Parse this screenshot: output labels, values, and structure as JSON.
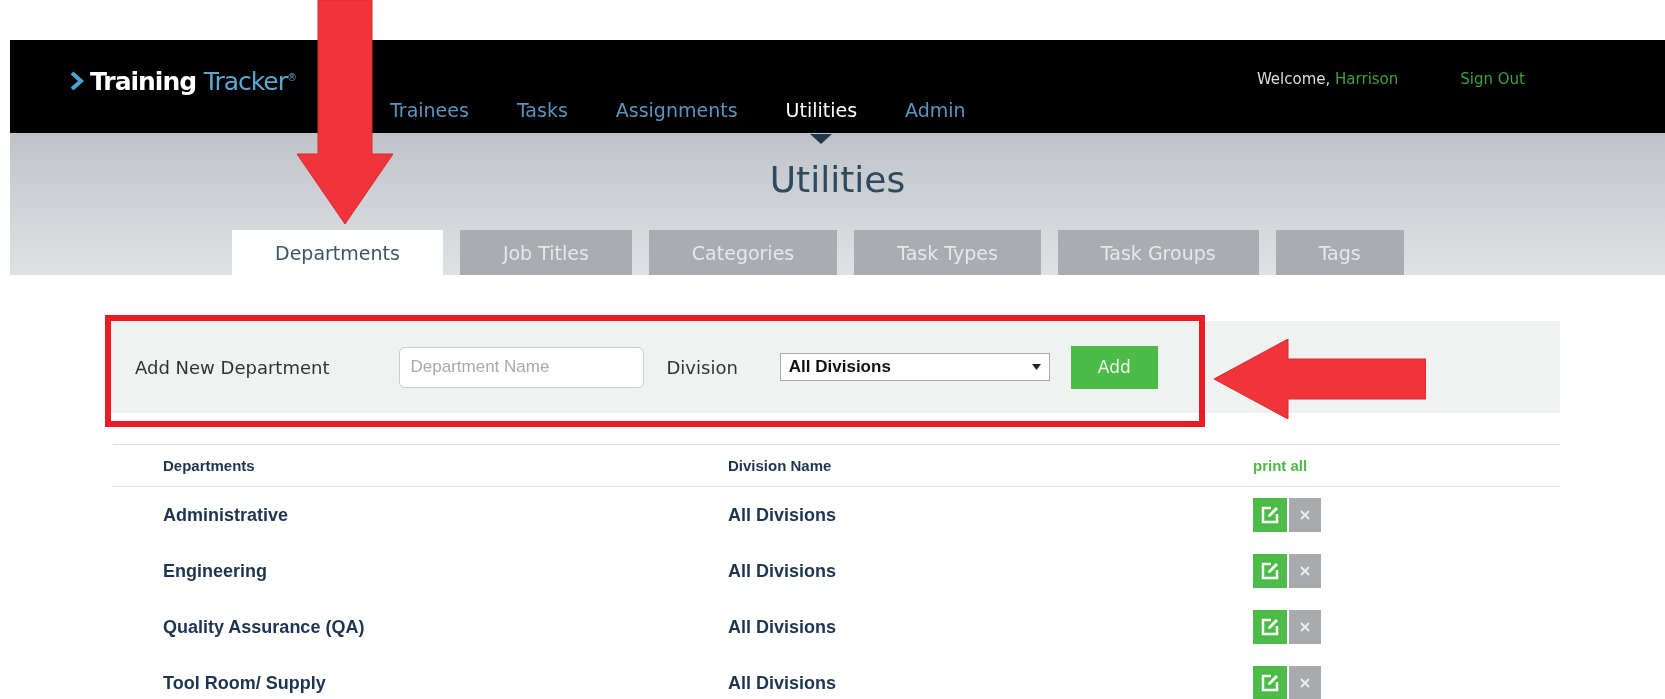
{
  "header": {
    "logo": {
      "first": "Training",
      "second": "Tracker$^{®}$"
    },
    "nav": [
      {
        "label": "Trainees",
        "selected": false
      },
      {
        "label": "Tasks",
        "selected": false
      },
      {
        "label": "Assignments",
        "selected": false
      },
      {
        "label": "Utilities",
        "selected": true
      },
      {
        "label": "Admin",
        "selected": false
      }
    ],
    "greeting": "Welcome,",
    "user": "Harrison",
    "sign_out": "Sign Out"
  },
  "page_title": "Utilities",
  "tabs": [
    {
      "label": "Departments",
      "selected": true
    },
    {
      "label": "Job Titles",
      "selected": false
    },
    {
      "label": "Categories",
      "selected": false
    },
    {
      "label": "Task Types",
      "selected": false
    },
    {
      "label": "Task Groups",
      "selected": false
    },
    {
      "label": "Tags",
      "selected": false
    }
  ],
  "add_form": {
    "label": "Add New Department",
    "placeholder": "Department Name",
    "division_label": "Division",
    "division_value": "All Divisions",
    "button": "Add"
  },
  "table": {
    "columns": [
      "Departments",
      "Division Name"
    ],
    "print_all": "print all",
    "rows": [
      {
        "department": "Administrative",
        "division": "All Divisions"
      },
      {
        "department": "Engineering",
        "division": "All Divisions"
      },
      {
        "department": "Quality Assurance (QA)",
        "division": "All Divisions"
      },
      {
        "department": "Tool Room/ Supply",
        "division": "All Divisions"
      }
    ]
  },
  "annotations": [
    {
      "kind": "down-arrow"
    },
    {
      "kind": "frame"
    },
    {
      "kind": "left-arrow"
    }
  ]
}
